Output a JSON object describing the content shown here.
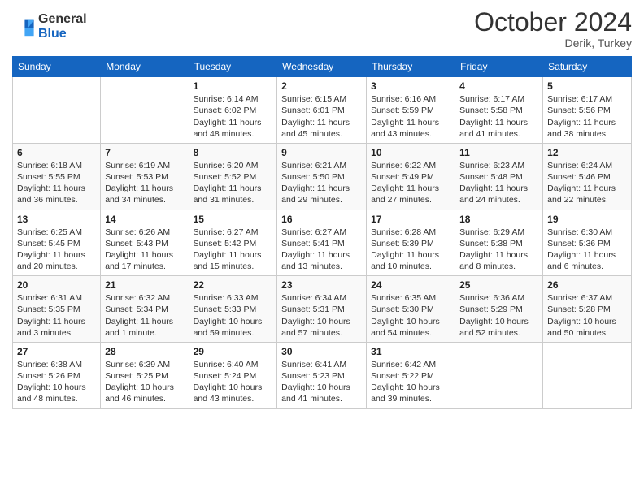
{
  "logo": {
    "general": "General",
    "blue": "Blue"
  },
  "title": "October 2024",
  "location": "Derik, Turkey",
  "days_header": [
    "Sunday",
    "Monday",
    "Tuesday",
    "Wednesday",
    "Thursday",
    "Friday",
    "Saturday"
  ],
  "weeks": [
    [
      {
        "num": "",
        "info": ""
      },
      {
        "num": "",
        "info": ""
      },
      {
        "num": "1",
        "info": "Sunrise: 6:14 AM\nSunset: 6:02 PM\nDaylight: 11 hours and 48 minutes."
      },
      {
        "num": "2",
        "info": "Sunrise: 6:15 AM\nSunset: 6:01 PM\nDaylight: 11 hours and 45 minutes."
      },
      {
        "num": "3",
        "info": "Sunrise: 6:16 AM\nSunset: 5:59 PM\nDaylight: 11 hours and 43 minutes."
      },
      {
        "num": "4",
        "info": "Sunrise: 6:17 AM\nSunset: 5:58 PM\nDaylight: 11 hours and 41 minutes."
      },
      {
        "num": "5",
        "info": "Sunrise: 6:17 AM\nSunset: 5:56 PM\nDaylight: 11 hours and 38 minutes."
      }
    ],
    [
      {
        "num": "6",
        "info": "Sunrise: 6:18 AM\nSunset: 5:55 PM\nDaylight: 11 hours and 36 minutes."
      },
      {
        "num": "7",
        "info": "Sunrise: 6:19 AM\nSunset: 5:53 PM\nDaylight: 11 hours and 34 minutes."
      },
      {
        "num": "8",
        "info": "Sunrise: 6:20 AM\nSunset: 5:52 PM\nDaylight: 11 hours and 31 minutes."
      },
      {
        "num": "9",
        "info": "Sunrise: 6:21 AM\nSunset: 5:50 PM\nDaylight: 11 hours and 29 minutes."
      },
      {
        "num": "10",
        "info": "Sunrise: 6:22 AM\nSunset: 5:49 PM\nDaylight: 11 hours and 27 minutes."
      },
      {
        "num": "11",
        "info": "Sunrise: 6:23 AM\nSunset: 5:48 PM\nDaylight: 11 hours and 24 minutes."
      },
      {
        "num": "12",
        "info": "Sunrise: 6:24 AM\nSunset: 5:46 PM\nDaylight: 11 hours and 22 minutes."
      }
    ],
    [
      {
        "num": "13",
        "info": "Sunrise: 6:25 AM\nSunset: 5:45 PM\nDaylight: 11 hours and 20 minutes."
      },
      {
        "num": "14",
        "info": "Sunrise: 6:26 AM\nSunset: 5:43 PM\nDaylight: 11 hours and 17 minutes."
      },
      {
        "num": "15",
        "info": "Sunrise: 6:27 AM\nSunset: 5:42 PM\nDaylight: 11 hours and 15 minutes."
      },
      {
        "num": "16",
        "info": "Sunrise: 6:27 AM\nSunset: 5:41 PM\nDaylight: 11 hours and 13 minutes."
      },
      {
        "num": "17",
        "info": "Sunrise: 6:28 AM\nSunset: 5:39 PM\nDaylight: 11 hours and 10 minutes."
      },
      {
        "num": "18",
        "info": "Sunrise: 6:29 AM\nSunset: 5:38 PM\nDaylight: 11 hours and 8 minutes."
      },
      {
        "num": "19",
        "info": "Sunrise: 6:30 AM\nSunset: 5:36 PM\nDaylight: 11 hours and 6 minutes."
      }
    ],
    [
      {
        "num": "20",
        "info": "Sunrise: 6:31 AM\nSunset: 5:35 PM\nDaylight: 11 hours and 3 minutes."
      },
      {
        "num": "21",
        "info": "Sunrise: 6:32 AM\nSunset: 5:34 PM\nDaylight: 11 hours and 1 minute."
      },
      {
        "num": "22",
        "info": "Sunrise: 6:33 AM\nSunset: 5:33 PM\nDaylight: 10 hours and 59 minutes."
      },
      {
        "num": "23",
        "info": "Sunrise: 6:34 AM\nSunset: 5:31 PM\nDaylight: 10 hours and 57 minutes."
      },
      {
        "num": "24",
        "info": "Sunrise: 6:35 AM\nSunset: 5:30 PM\nDaylight: 10 hours and 54 minutes."
      },
      {
        "num": "25",
        "info": "Sunrise: 6:36 AM\nSunset: 5:29 PM\nDaylight: 10 hours and 52 minutes."
      },
      {
        "num": "26",
        "info": "Sunrise: 6:37 AM\nSunset: 5:28 PM\nDaylight: 10 hours and 50 minutes."
      }
    ],
    [
      {
        "num": "27",
        "info": "Sunrise: 6:38 AM\nSunset: 5:26 PM\nDaylight: 10 hours and 48 minutes."
      },
      {
        "num": "28",
        "info": "Sunrise: 6:39 AM\nSunset: 5:25 PM\nDaylight: 10 hours and 46 minutes."
      },
      {
        "num": "29",
        "info": "Sunrise: 6:40 AM\nSunset: 5:24 PM\nDaylight: 10 hours and 43 minutes."
      },
      {
        "num": "30",
        "info": "Sunrise: 6:41 AM\nSunset: 5:23 PM\nDaylight: 10 hours and 41 minutes."
      },
      {
        "num": "31",
        "info": "Sunrise: 6:42 AM\nSunset: 5:22 PM\nDaylight: 10 hours and 39 minutes."
      },
      {
        "num": "",
        "info": ""
      },
      {
        "num": "",
        "info": ""
      }
    ]
  ]
}
